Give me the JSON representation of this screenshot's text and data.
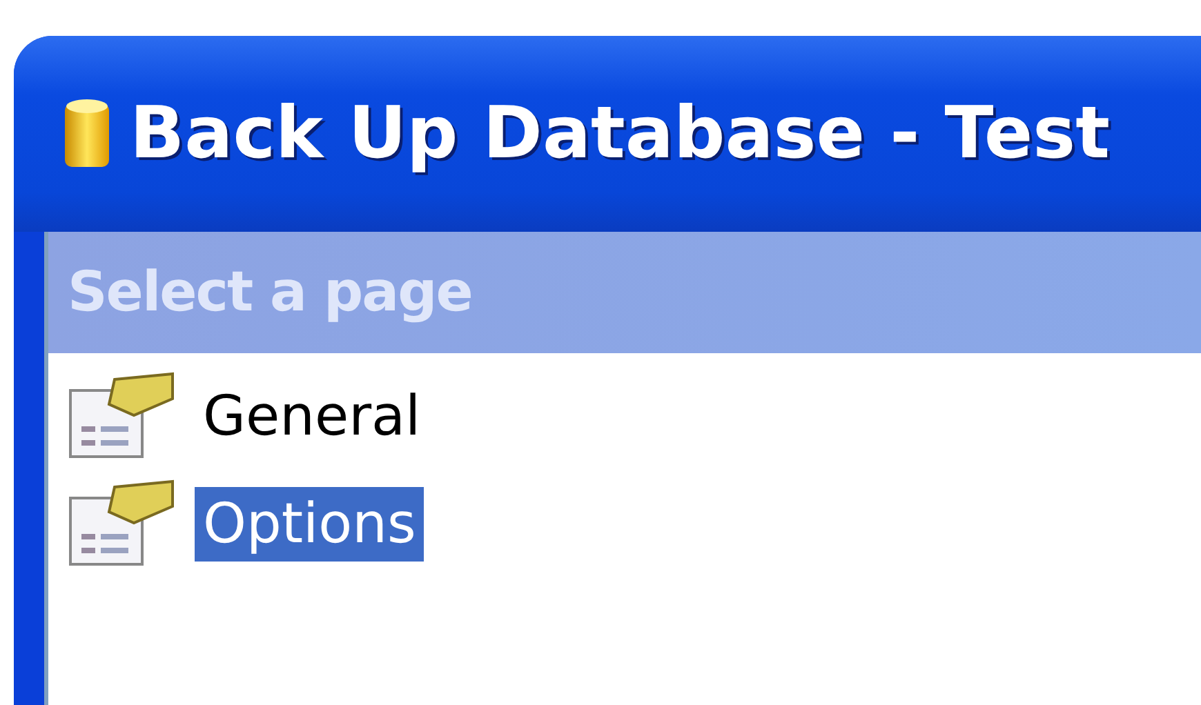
{
  "window": {
    "title": "Back Up Database - Test"
  },
  "sidebar": {
    "header": "Select a page",
    "items": [
      {
        "label": "General",
        "selected": false
      },
      {
        "label": "Options",
        "selected": true
      }
    ]
  }
}
